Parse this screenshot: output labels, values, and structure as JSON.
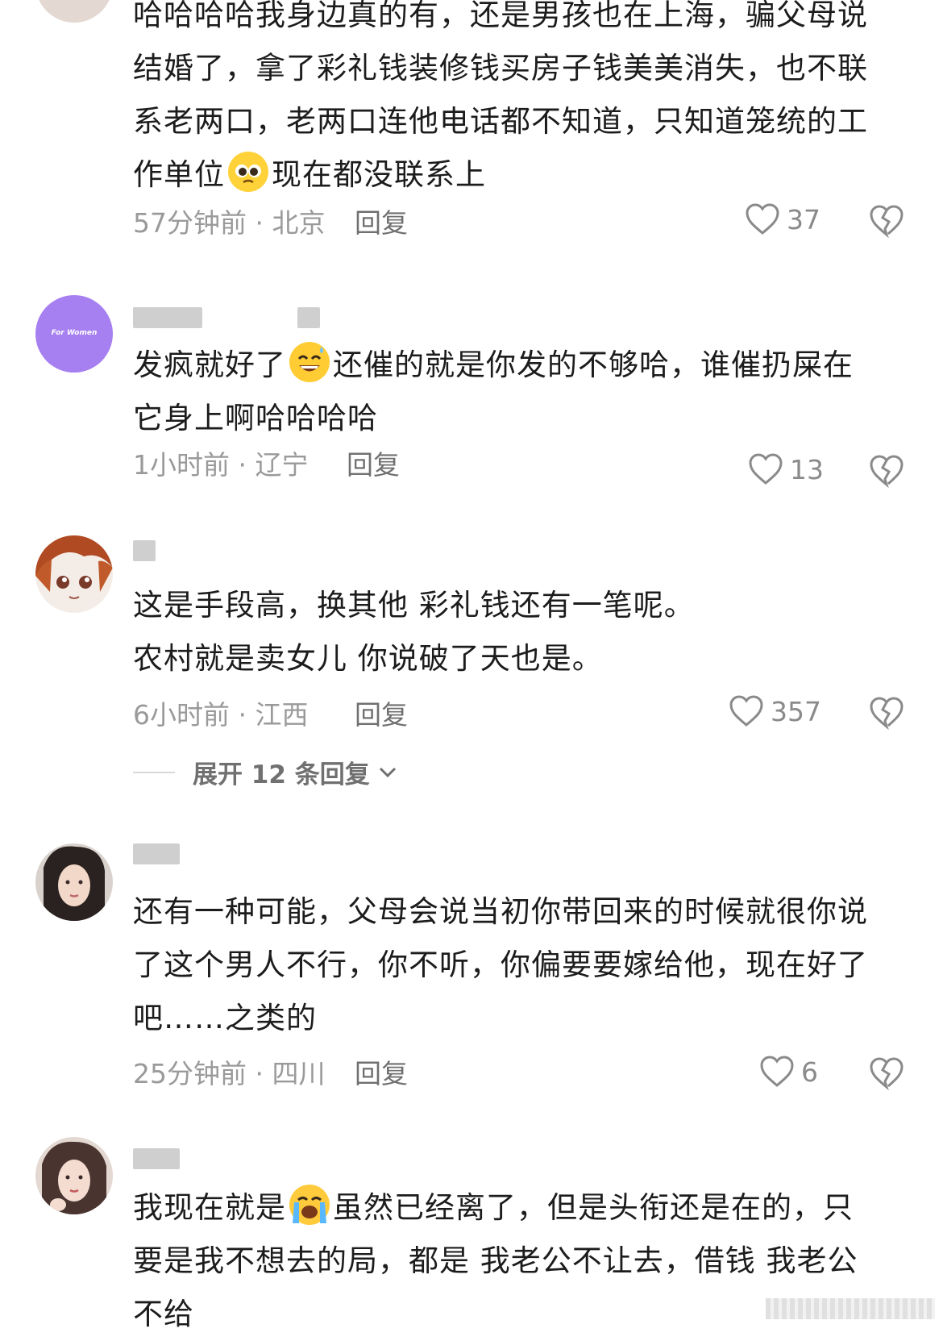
{
  "comments": [
    {
      "lines": [
        "哈哈哈哈我身边真的有，还是男孩也在上海，骗父母说",
        "结婚了，拿了彩礼钱装修钱买房子钱美美消失，也不联",
        "系老两口，老两口连他电话都不知道，只知道笼统的工"
      ],
      "line4_before": "作单位",
      "line4_after": "现在都没联系上",
      "emoji": "pleading-face-emoji",
      "time_location": "57分钟前 · 北京",
      "reply": "回复",
      "likes": "37"
    },
    {
      "avatar_text": "For Women",
      "line1_before": "发疯就好了",
      "line1_after": "还催的就是你发的不够哈，谁催扔屎在",
      "line2": "它身上啊哈哈哈哈",
      "emoji": "grinning-sweat-emoji",
      "time_location": "1小时前 · 辽宁",
      "reply": "回复",
      "likes": "13"
    },
    {
      "lines": [
        "这是手段高，换其他  彩礼钱还有一笔呢。",
        "农村就是卖女儿  你说破了天也是。"
      ],
      "time_location": "6小时前 · 江西",
      "reply": "回复",
      "likes": "357",
      "expand": "展开 12 条回复"
    },
    {
      "lines": [
        "还有一种可能，父母会说当初你带回来的时候就很你说",
        "了这个男人不行，你不听，你偏要要嫁给他，现在好了",
        "吧……之类的"
      ],
      "time_location": "25分钟前 · 四川",
      "reply": "回复",
      "likes": "6"
    },
    {
      "line1_before": "我现在就是",
      "line1_after": "虽然已经离了，但是头衔还是在的，只",
      "lines": [
        "要是我不想去的局，都是 我老公不让去，借钱 我老公",
        "不给"
      ],
      "emoji": "loudly-crying-emoji"
    }
  ],
  "icons": {
    "like": "heart-outline-icon",
    "dislike": "broken-heart-icon",
    "expand": "chevron-down-icon"
  },
  "colors": {
    "meta_gray": "#9a9a9a",
    "text": "#1c1c1c",
    "avatar_purple": "#a67ff0"
  }
}
